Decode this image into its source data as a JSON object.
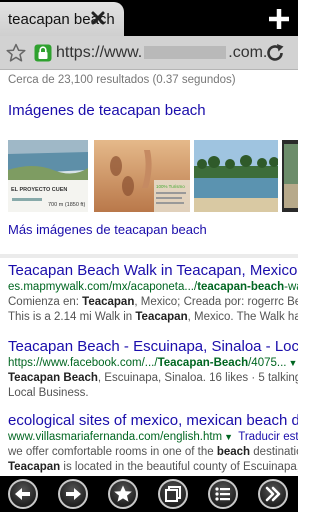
{
  "tab": {
    "title": "teacapan beach"
  },
  "urlbar": {
    "prefix": "https://www.",
    "suffix": ".com."
  },
  "search": {
    "stats": "Cerca de 23,100 resultados (0.37 segundos)",
    "images_heading": "Imágenes de teacapan beach",
    "more_images": "Más imágenes de teacapan beach",
    "thumbs": [
      {
        "caption_line1": "EL PROYECTO CUEN",
        "caption_line2": "700 m (1850 ft)"
      },
      {
        "caption_line1": "100% Turismo",
        "caption_line2": ""
      },
      {
        "caption_line1": "",
        "caption_line2": ""
      },
      {
        "caption_line1": "",
        "caption_line2": ""
      }
    ]
  },
  "results": [
    {
      "title": "Teacapan Beach Walk in Teacapan, Mexico | M",
      "url_pre": "es.mapmywalk.com/mx/acaponeta.../",
      "url_bold": "teacapan-beach",
      "url_post": "-walk",
      "snip1_pre": "Comienza en: ",
      "snip1_b1": "Teacapan",
      "snip1_mid": ", Mexico; Creada por: rogerrc Best Time:",
      "snip2_pre": "This is a 2.14 mi Walk in ",
      "snip2_b1": "Teacapan",
      "snip2_post": ", Mexico. The Walk has a to",
      "snip3": ""
    },
    {
      "title": "Teacapan Beach - Escuinapa, Sinaloa - Local B",
      "url_pre": "https://www.facebook.com/.../",
      "url_bold": "Teacapan-Beach",
      "url_post": "/4075...",
      "snip1_b1": "Teacapan Beach",
      "snip1_post": ", Escuinapa, Sinaloa. 16 likes · 5 talking about th",
      "snip2": "Local Business."
    },
    {
      "title": "ecological sites of mexico, mexican beach des",
      "url_pre": "www.villasmariafernanda.com/english.htm",
      "traducir": "Traducir esta",
      "snip1_pre": "we offer comfortable rooms in one of the ",
      "snip1_b1": "beach",
      "snip1_post": " destinations in",
      "snip2_b1": "Teacapan",
      "snip2_post": " is located in the beautiful county of Escuinapa, 61 m"
    }
  ],
  "colors": {
    "link": "#1a0dab",
    "url_green": "#006621",
    "toolbar_bg": "#000000",
    "lock_green": "#2fa12f"
  }
}
